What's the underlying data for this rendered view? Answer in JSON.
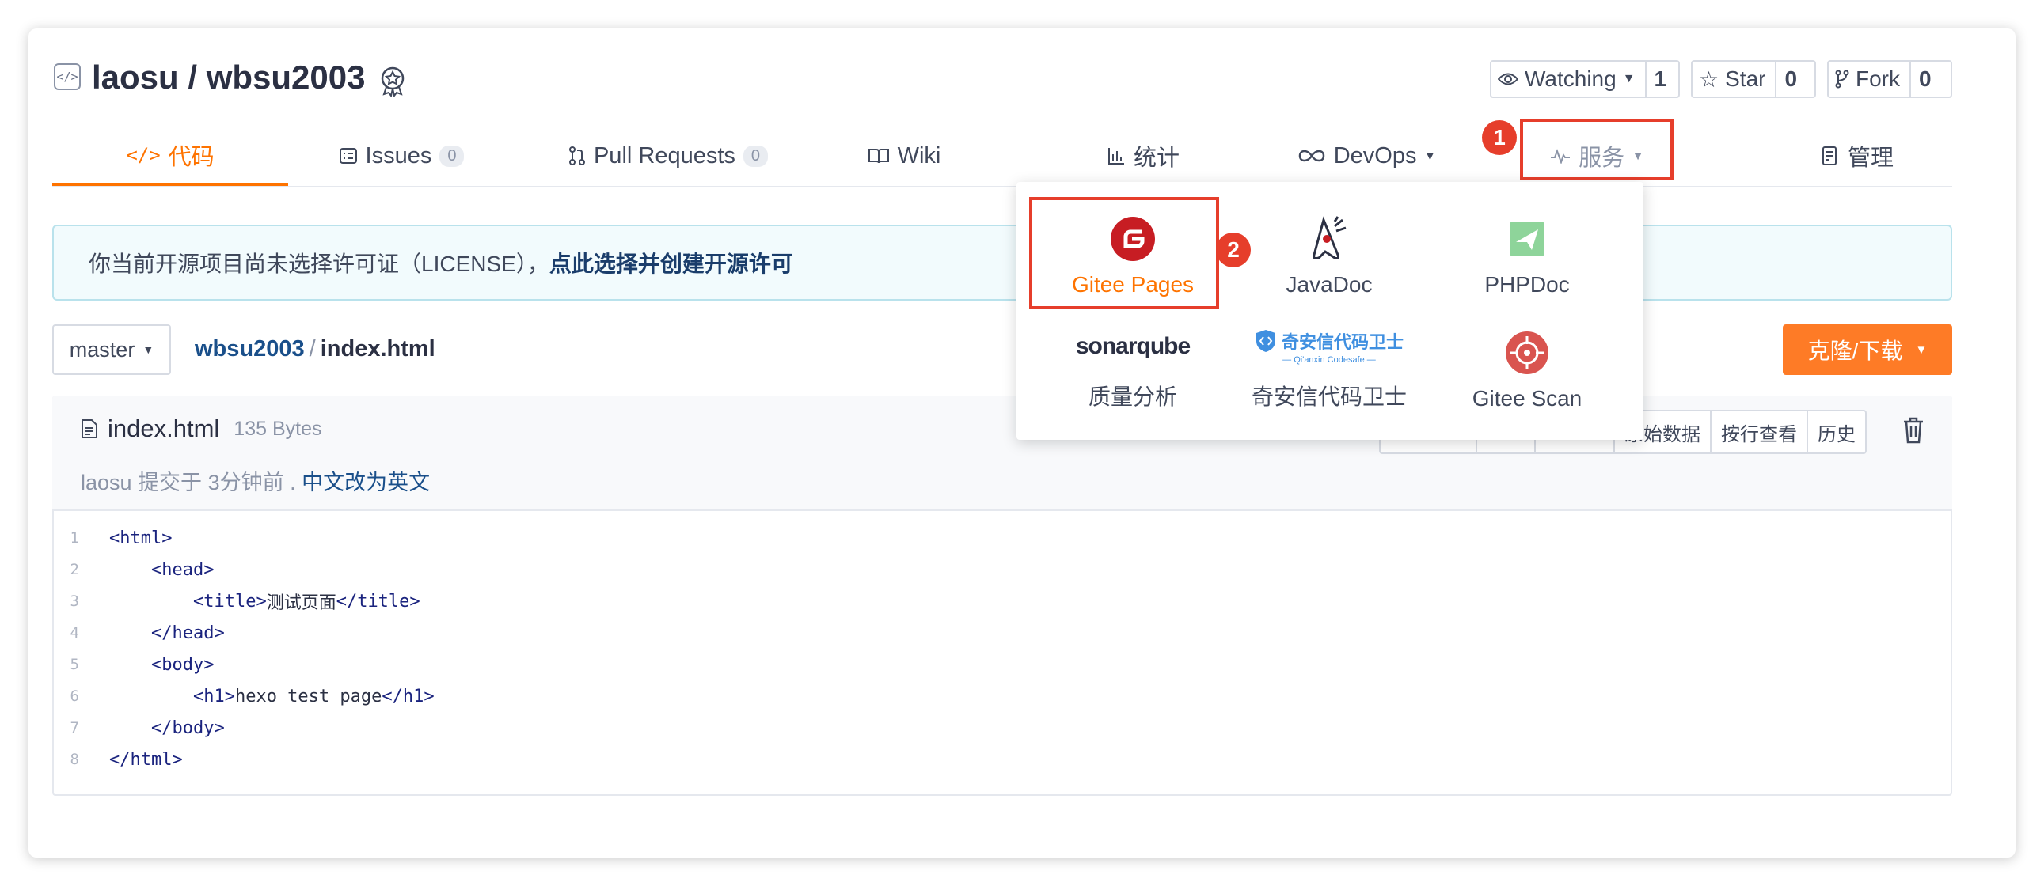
{
  "repo": {
    "title": "laosu / wbsu2003"
  },
  "actions": {
    "watch": {
      "label": "Watching",
      "count": "1"
    },
    "star": {
      "label": "Star",
      "count": "0"
    },
    "fork": {
      "label": "Fork",
      "count": "0"
    }
  },
  "tabs": [
    {
      "label": "代码",
      "active": true
    },
    {
      "label": "Issues",
      "count": "0"
    },
    {
      "label": "Pull Requests",
      "count": "0"
    },
    {
      "label": "Wiki"
    },
    {
      "label": "统计"
    },
    {
      "label": "DevOps"
    },
    {
      "label": "服务"
    },
    {
      "label": "管理"
    }
  ],
  "markers": {
    "one": "1",
    "two": "2"
  },
  "services_menu": {
    "items": [
      {
        "label": "Gitee Pages",
        "icon": "gitee-icon",
        "color": "#c71d23"
      },
      {
        "label": "JavaDoc",
        "icon": "java-duke-icon"
      },
      {
        "label": "PHPDoc",
        "icon": "phpdoc-icon",
        "color": "#8ed49a"
      },
      {
        "label": "质量分析",
        "icon": "sonarqube-logo",
        "logo_text": "sonarqube"
      },
      {
        "label": "奇安信代码卫士",
        "icon": "qianxin-codesafe-logo",
        "logo_text": "奇安信代码卫士",
        "logo_subtext": "— Qi'anxin Codesafe —"
      },
      {
        "label": "Gitee Scan",
        "icon": "gitee-scan-icon",
        "color": "#d9544f"
      }
    ]
  },
  "notice": {
    "text": "你当前开源项目尚未选择许可证（LICENSE），",
    "link": "点此选择并创建开源许可"
  },
  "branch": {
    "name": "master"
  },
  "breadcrumb": {
    "repo": "wbsu2003",
    "sep": "/",
    "file": "index.html"
  },
  "clone_button": "克隆/下载",
  "file": {
    "name": "index.html",
    "size": "135 Bytes",
    "commit_author": "laosu",
    "commit_text": "提交于 3分钟前 .",
    "commit_message": "中文改为英文",
    "buttons": [
      "原始数据",
      "按行查看",
      "历史"
    ]
  },
  "code": [
    {
      "n": "1",
      "indent": "",
      "tag1": "<html>",
      "text": "",
      "tag2": ""
    },
    {
      "n": "2",
      "indent": "    ",
      "tag1": "<head>",
      "text": "",
      "tag2": ""
    },
    {
      "n": "3",
      "indent": "        ",
      "tag1": "<title>",
      "text": "测试页面",
      "tag2": "</title>"
    },
    {
      "n": "4",
      "indent": "    ",
      "tag1": "</head>",
      "text": "",
      "tag2": ""
    },
    {
      "n": "5",
      "indent": "    ",
      "tag1": "<body>",
      "text": "",
      "tag2": ""
    },
    {
      "n": "6",
      "indent": "        ",
      "tag1": "<h1>",
      "text": "hexo test page",
      "tag2": "</h1>"
    },
    {
      "n": "7",
      "indent": "    ",
      "tag1": "</body>",
      "text": "",
      "tag2": ""
    },
    {
      "n": "8",
      "indent": "",
      "tag1": "</html>",
      "text": "",
      "tag2": ""
    }
  ],
  "colors": {
    "accent": "#fe7300",
    "highlight": "#e63e2b",
    "link": "#1a4f8a"
  }
}
